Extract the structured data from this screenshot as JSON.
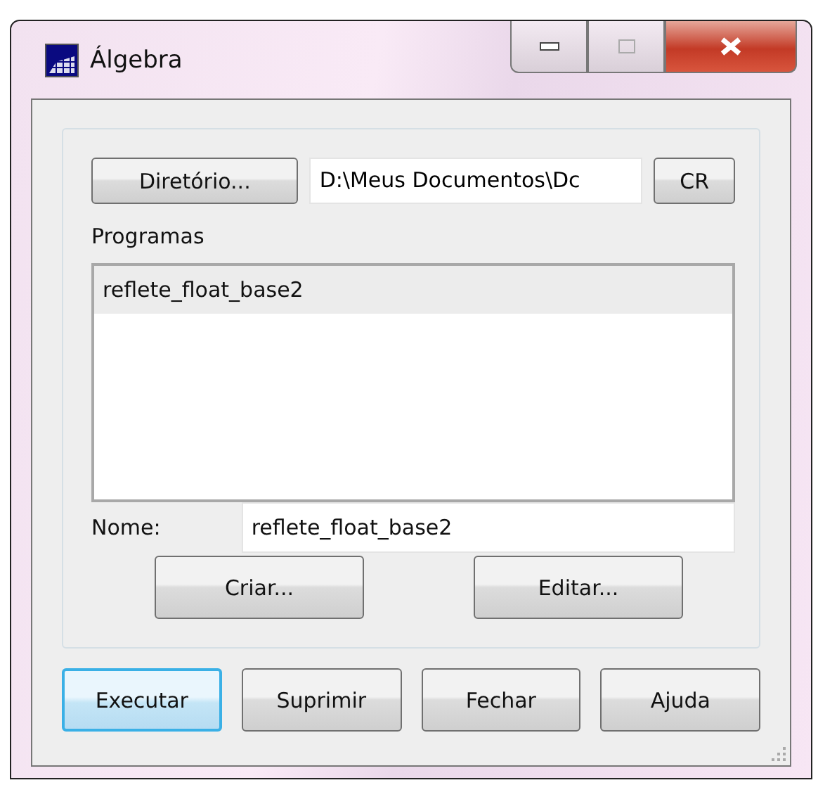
{
  "window": {
    "title": "Álgebra"
  },
  "directory": {
    "button": "Diretório...",
    "path": "D:\\Meus Documentos\\Dc",
    "cr_button": "CR"
  },
  "programs": {
    "label": "Programas",
    "items": [
      {
        "label": "reflete_float_base2",
        "selected": true
      }
    ]
  },
  "name_field": {
    "label": "Nome:",
    "value": "reflete_float_base2"
  },
  "actions": [
    "Criar...",
    "Editar..."
  ],
  "buttons": [
    {
      "label": "Executar",
      "default": true
    },
    {
      "label": "Suprimir",
      "default": false
    },
    {
      "label": "Fechar",
      "default": false
    },
    {
      "label": "Ajuda",
      "default": false
    }
  ]
}
